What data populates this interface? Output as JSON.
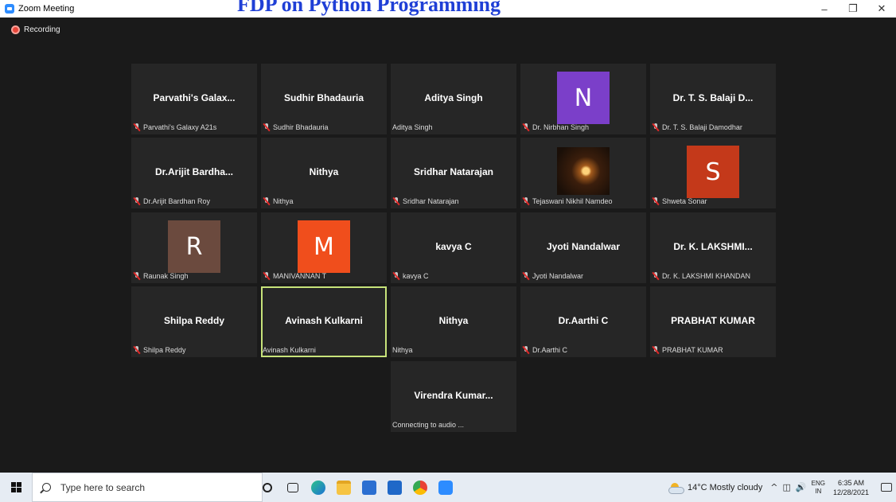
{
  "window": {
    "title": "Zoom Meeting",
    "overlay_text": "FDP on Python Programming"
  },
  "recording_label": "Recording",
  "tiles": [
    {
      "center_name": "Parvathi's Galax...",
      "name": "Parvathi's Galaxy A21s",
      "muted": true,
      "avatar": null
    },
    {
      "center_name": "Sudhir Bhadauria",
      "name": "Sudhir Bhadauria",
      "muted": true,
      "avatar": null
    },
    {
      "center_name": "Aditya Singh",
      "name": "Aditya Singh",
      "muted": false,
      "avatar": null
    },
    {
      "center_name": "",
      "name": "Dr. Nirbhan Singh",
      "muted": true,
      "avatar": {
        "letter": "N",
        "color": "#7b3fc9"
      }
    },
    {
      "center_name": "Dr. T. S. Balaji D...",
      "name": "Dr. T. S. Balaji Damodhar",
      "muted": true,
      "avatar": null
    },
    {
      "center_name": "Dr.Arijit Bardha...",
      "name": "Dr.Arijit Bardhan Roy",
      "muted": true,
      "avatar": null
    },
    {
      "center_name": "Nithya",
      "name": "Nithya",
      "muted": true,
      "avatar": null
    },
    {
      "center_name": "Sridhar Natarajan",
      "name": "Sridhar Natarajan",
      "muted": true,
      "avatar": null
    },
    {
      "center_name": "",
      "name": "Tejaswani Nikhil Namdeo",
      "muted": true,
      "avatar": null,
      "photo": "diya-lamp"
    },
    {
      "center_name": "",
      "name": "Shweta Sonar",
      "muted": true,
      "avatar": {
        "letter": "S",
        "color": "#c4391a"
      }
    },
    {
      "center_name": "",
      "name": "Raunak Singh",
      "muted": true,
      "avatar": {
        "letter": "R",
        "color": "#6b4a3e"
      }
    },
    {
      "center_name": "",
      "name": "MANIVANNAN T",
      "muted": true,
      "avatar": {
        "letter": "M",
        "color": "#f04e1c"
      }
    },
    {
      "center_name": "kavya C",
      "name": "kavya C",
      "muted": true,
      "avatar": null
    },
    {
      "center_name": "Jyoti Nandalwar",
      "name": "Jyoti Nandalwar",
      "muted": true,
      "avatar": null
    },
    {
      "center_name": "Dr. K. LAKSHMI...",
      "name": "Dr. K. LAKSHMI KHANDAN",
      "muted": true,
      "avatar": null
    },
    {
      "center_name": "Shilpa Reddy",
      "name": "Shilpa Reddy",
      "muted": true,
      "avatar": null
    },
    {
      "center_name": "Avinash Kulkarni",
      "name": "Avinash Kulkarni",
      "muted": false,
      "avatar": null,
      "active_speaker": true
    },
    {
      "center_name": "Nithya",
      "name": "Nithya",
      "muted": false,
      "avatar": null
    },
    {
      "center_name": "Dr.Aarthi C",
      "name": "Dr.Aarthi C",
      "muted": true,
      "avatar": null
    },
    {
      "center_name": "PRABHAT KUMAR",
      "name": "PRABHAT KUMAR",
      "muted": true,
      "avatar": null
    },
    {
      "center_name": "Virendra Kumar...",
      "name": "Connecting to audio ...",
      "muted": false,
      "avatar": null
    }
  ],
  "taskbar": {
    "search_placeholder": "Type here to search",
    "weather": "14°C  Mostly cloudy",
    "lang_top": "ENG",
    "lang_bottom": "IN",
    "time": "6:35 AM",
    "date": "12/28/2021",
    "app_icons": [
      "cortana-icon",
      "task-view-icon",
      "edge-icon",
      "file-explorer-icon",
      "store-icon",
      "mail-icon",
      "chrome-icon",
      "zoom-icon"
    ]
  }
}
